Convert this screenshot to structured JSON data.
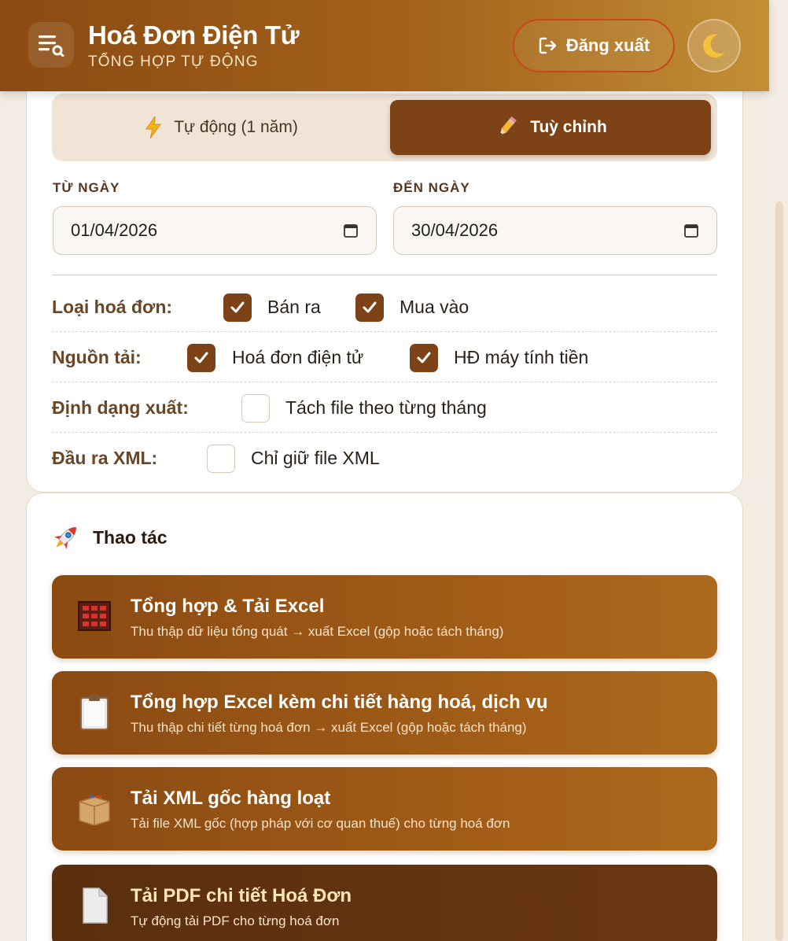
{
  "header": {
    "title": "Hoá Đơn Điện Tử",
    "subtitle": "TỔNG HỢP TỰ ĐỘNG",
    "logout_label": "Đăng xuất",
    "menu_icon": "menu-filter-icon",
    "theme_icon": "moon-icon"
  },
  "mode_toggle": {
    "auto_label": "Tự động (1 năm)",
    "custom_label": "Tuỳ chỉnh",
    "selected": "custom"
  },
  "date_range": {
    "from_label": "TỪ NGÀY",
    "from_value": "01/04/2026",
    "to_label": "ĐẾN NGÀY",
    "to_value": "30/04/2026"
  },
  "options": {
    "invoice_type": {
      "label": "Loại hoá đơn:",
      "items": [
        {
          "label": "Bán ra",
          "checked": true
        },
        {
          "label": "Mua vào",
          "checked": true
        }
      ]
    },
    "source": {
      "label": "Nguồn tải:",
      "items": [
        {
          "label": "Hoá đơn điện tử",
          "checked": true
        },
        {
          "label": "HĐ máy tính tiền",
          "checked": true
        }
      ]
    },
    "export_format": {
      "label": "Định dạng xuất:",
      "items": [
        {
          "label": "Tách file theo từng tháng",
          "checked": false
        }
      ]
    },
    "xml_output": {
      "label": "Đầu ra XML:",
      "items": [
        {
          "label": "Chỉ giữ file XML",
          "checked": false
        }
      ]
    }
  },
  "actions_section": {
    "title": "Thao tác",
    "icon": "rocket-icon",
    "items": [
      {
        "title": "Tổng hợp & Tải Excel",
        "desc": "Thu thập dữ liệu tổng quát → xuất Excel (gộp hoặc tách tháng)",
        "icon": "abacus-icon"
      },
      {
        "title": "Tổng hợp Excel kèm chi tiết hàng hoá, dịch vụ",
        "desc": "Thu thập chi tiết từng hoá đơn → xuất Excel (gộp hoặc tách tháng)",
        "icon": "clipboard-icon"
      },
      {
        "title": "Tải XML gốc hàng loạt",
        "desc": "Tải file XML gốc (hợp pháp với cơ quan thuế) cho từng hoá đơn",
        "icon": "package-icon"
      },
      {
        "title": "Tải PDF chi tiết Hoá Đơn",
        "desc": "Tự động tải PDF cho từng hoá đơn",
        "icon": "document-icon"
      }
    ]
  }
}
